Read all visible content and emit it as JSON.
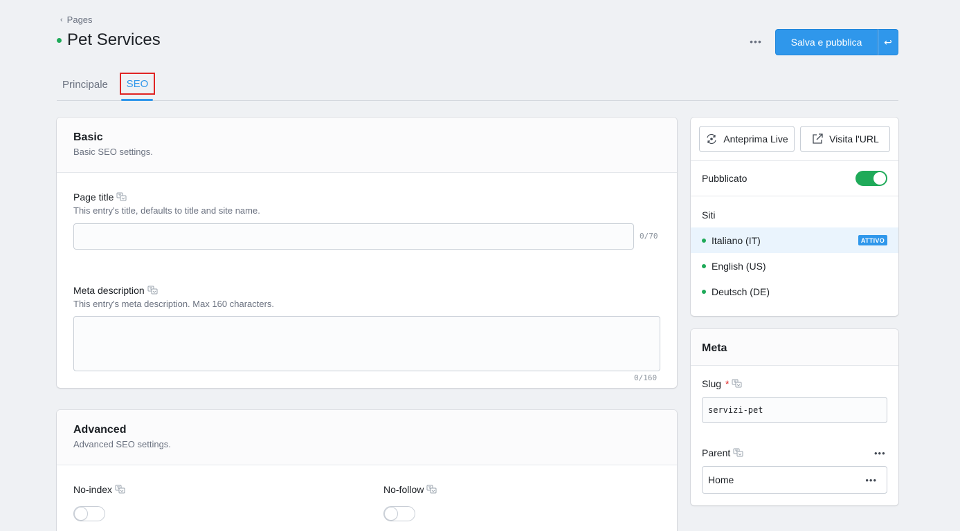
{
  "breadcrumb": {
    "label": "Pages"
  },
  "header": {
    "title": "Pet Services",
    "more": "•••",
    "publish_label": "Salva e pubblica",
    "publish_arrow": "↩"
  },
  "tabs": [
    {
      "label": "Principale"
    },
    {
      "label": "SEO"
    }
  ],
  "basic": {
    "title": "Basic",
    "subtitle": "Basic SEO settings.",
    "page_title": {
      "label": "Page title",
      "help": "This entry's title, defaults to title and site name.",
      "value": "",
      "counter": "0/70"
    },
    "meta_description": {
      "label": "Meta description",
      "help": "This entry's meta description. Max 160 characters.",
      "value": "",
      "counter": "0/160"
    }
  },
  "advanced": {
    "title": "Advanced",
    "subtitle": "Advanced SEO settings.",
    "no_index": {
      "label": "No-index",
      "enabled": false
    },
    "no_follow": {
      "label": "No-follow",
      "enabled": false
    }
  },
  "sidebar": {
    "live_preview": "Anteprima Live",
    "visit_url": "Visita l'URL",
    "published": {
      "label": "Pubblicato",
      "enabled": true
    },
    "sites_label": "Siti",
    "sites": [
      {
        "name": "Italiano (IT)",
        "badge": "ATTIVO"
      },
      {
        "name": "English (US)"
      },
      {
        "name": "Deutsch (DE)"
      }
    ]
  },
  "meta": {
    "title": "Meta",
    "slug": {
      "label": "Slug",
      "required": "*",
      "value": "servizi-pet"
    },
    "parent": {
      "label": "Parent",
      "value": "Home",
      "more": "•••"
    }
  },
  "colors": {
    "accent": "#2f97eb",
    "status_green": "#1faa59",
    "highlight_red": "#e02424"
  }
}
